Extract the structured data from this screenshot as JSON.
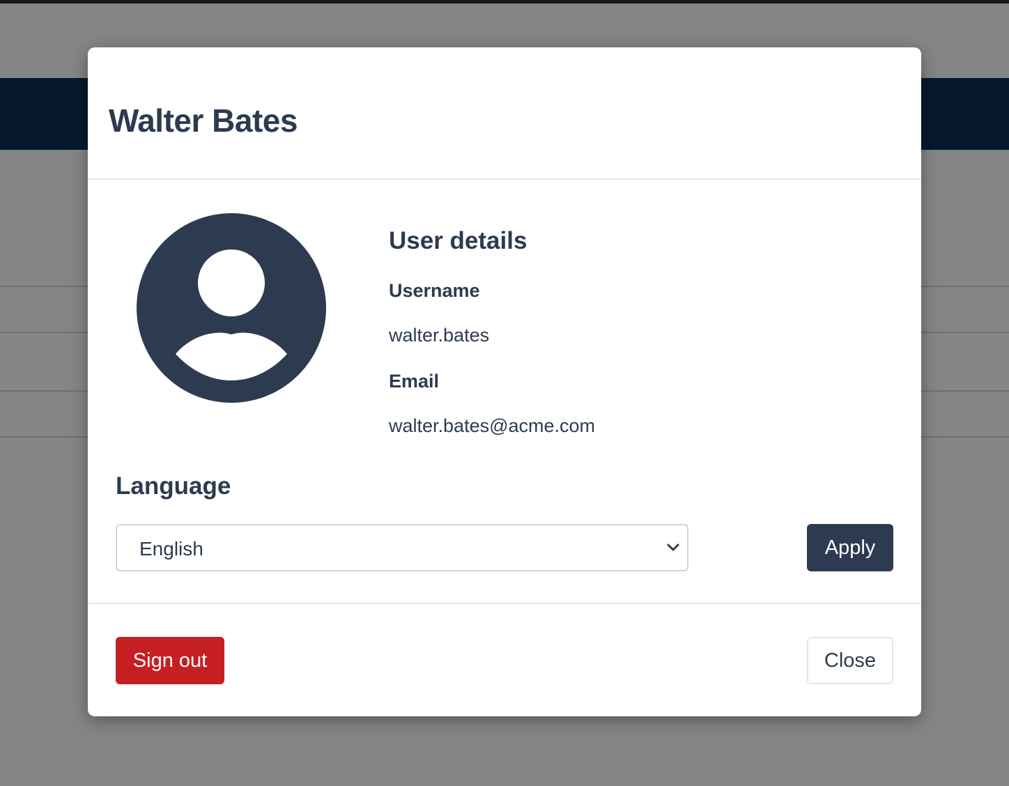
{
  "modal": {
    "title": "Walter Bates",
    "avatar_icon": "user-circle-icon",
    "details": {
      "heading": "User details",
      "username_label": "Username",
      "username_value": "walter.bates",
      "email_label": "Email",
      "email_value": "walter.bates@acme.com"
    },
    "language": {
      "heading": "Language",
      "selected": "English",
      "chevron_icon": "chevron-down-icon",
      "apply_label": "Apply"
    },
    "footer": {
      "signout_label": "Sign out",
      "close_label": "Close"
    }
  },
  "colors": {
    "primary": "#2d3b50",
    "danger": "#c51f24",
    "navbar": "#0a2e57"
  }
}
